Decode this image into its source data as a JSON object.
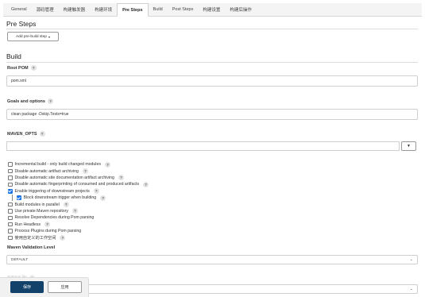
{
  "tabs": [
    {
      "label": "General",
      "active": false
    },
    {
      "label": "源码管理",
      "active": false
    },
    {
      "label": "构建触发器",
      "active": false
    },
    {
      "label": "构建环境",
      "active": false
    },
    {
      "label": "Pre Steps",
      "active": true
    },
    {
      "label": "Build",
      "active": false
    },
    {
      "label": "Post Steps",
      "active": false
    },
    {
      "label": "构建设置",
      "active": false
    },
    {
      "label": "构建后操作",
      "active": false
    }
  ],
  "pre_steps": {
    "title": "Pre Steps",
    "add_button_label": "Add pre-build step",
    "add_button_caret": "▾"
  },
  "build": {
    "title": "Build",
    "root_pom": {
      "label": "Root POM",
      "value": "pom.xml"
    },
    "goals": {
      "label": "Goals and options",
      "value": "clean package -Dskip.Tests=true"
    },
    "maven_opts": {
      "label": "MAVEN_OPTS",
      "value": "",
      "expand_icon": "▼"
    },
    "help_glyph": "?"
  },
  "options": [
    {
      "label": "Incremental build - only build changed modules",
      "checked": false,
      "indent": false
    },
    {
      "label": "Disable automatic artifact archiving",
      "checked": false,
      "indent": false
    },
    {
      "label": "Disable automatic site documentation artifact archiving",
      "checked": false,
      "indent": false
    },
    {
      "label": "Disable automatic fingerprinting of consumed and produced artifacts",
      "checked": false,
      "indent": false
    },
    {
      "label": "Enable triggering of downstream projects",
      "checked": true,
      "indent": false
    },
    {
      "label": "Block downstream trigger when building",
      "checked": true,
      "indent": true
    },
    {
      "label": "Build modules in parallel",
      "checked": false,
      "indent": false
    },
    {
      "label": "Use private Maven repository",
      "checked": false,
      "indent": false
    },
    {
      "label": "Resolve Dependencies during Pom parsing",
      "checked": false,
      "indent": false
    },
    {
      "label": "Run Headless",
      "checked": false,
      "indent": false
    },
    {
      "label": "Process Plugins during Pom parsing",
      "checked": false,
      "indent": false
    },
    {
      "label": "使用自定义的工作空间",
      "checked": false,
      "indent": false
    }
  ],
  "maven_validation": {
    "label": "Maven Validation Level",
    "selected": "DEFAULT"
  },
  "settings_file": {
    "label": "Settings file",
    "selected": ""
  },
  "footer": {
    "save_label": "保存",
    "apply_label": "应用"
  },
  "colors": {
    "save_button": "#12426a",
    "checkbox_checked": "#1a73e8"
  }
}
